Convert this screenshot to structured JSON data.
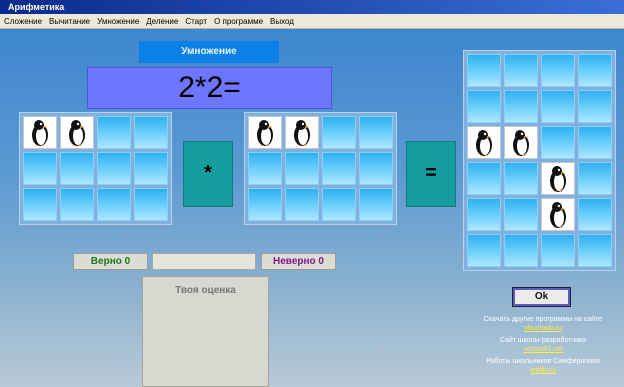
{
  "window": {
    "title": "Арифметика"
  },
  "menu": [
    "Сложение",
    "Вычитание",
    "Умножение",
    "Деление",
    "Старт",
    "О программе",
    "Выход"
  ],
  "operation_label": "Умножение",
  "expression": "2*2=",
  "operator_sign": "*",
  "equals_sign": "=",
  "grid_left": {
    "penguins": [
      0,
      1
    ]
  },
  "grid_middle": {
    "penguins": [
      0,
      1
    ]
  },
  "grid_result": {
    "penguins": [
      8,
      9,
      14,
      18
    ]
  },
  "score": {
    "correct_label": "Верно 0",
    "wrong_label": "Неверно 0"
  },
  "grade": {
    "title": "Твоя оценка"
  },
  "ok_label": "Ok",
  "links": [
    {
      "caption": "Скачать другие программы на сайте",
      "link": "obuchaiki.ru"
    },
    {
      "caption": "Сайт школы-разработчика",
      "link": "school43.net"
    },
    {
      "caption": "Работы школьников Симферополя",
      "link": "smfiki.ru"
    }
  ],
  "colors": {
    "correct": "#1a7a1a",
    "wrong": "#7a1a8a"
  }
}
